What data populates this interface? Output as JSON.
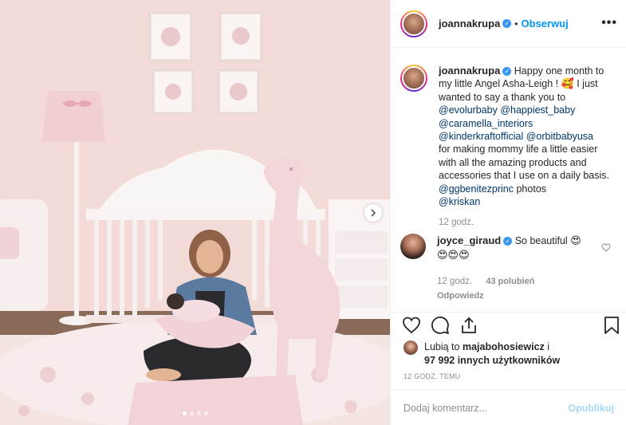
{
  "header": {
    "username": "joannakrupa",
    "separator": "•",
    "follow_label": "Obserwuj",
    "more_label": "•••"
  },
  "caption": {
    "username": "joannakrupa",
    "text_1": "Happy one month to my little Angel Asha-Leigh ! ",
    "emoji_1": "🥰",
    "text_2": " I just wanted to say a thank you to",
    "mention_1": "@evolurbaby",
    "mention_2": "@happiest_baby",
    "mention_3": "@caramella_interiors",
    "mention_4": "@kinderkraftofficial",
    "mention_5": "@orbitbabyusa",
    "text_3": "for making mommy life a little easier with all the amazing products and accessories that I use on a daily basis.",
    "mention_6": "@ggbenitezprinc",
    "text_4": "photos",
    "mention_7": "@kriskan",
    "time": "12 godz."
  },
  "comment": {
    "username": "joyce_giraud",
    "text": "So beautiful",
    "emoji_1": "😍",
    "emoji_2": "😍😍😍",
    "time": "12 godz.",
    "likes": "43 polubień",
    "reply_label": "Odpowiedz"
  },
  "likes": {
    "prefix": "Lubią to",
    "user": "majabohosiewicz",
    "conj": "i",
    "count": "97 992 innych użytkowników"
  },
  "post_date": "12 GODZ. TEMU",
  "add_comment": {
    "placeholder": "Dodaj komentarz...",
    "publish_label": "Opublikuj"
  },
  "carousel": {
    "slides": 4,
    "active_index": 0
  },
  "colors": {
    "accent": "#0095f6",
    "link": "#00376b",
    "verified": "#3897f0",
    "muted": "#8e8e8e"
  }
}
